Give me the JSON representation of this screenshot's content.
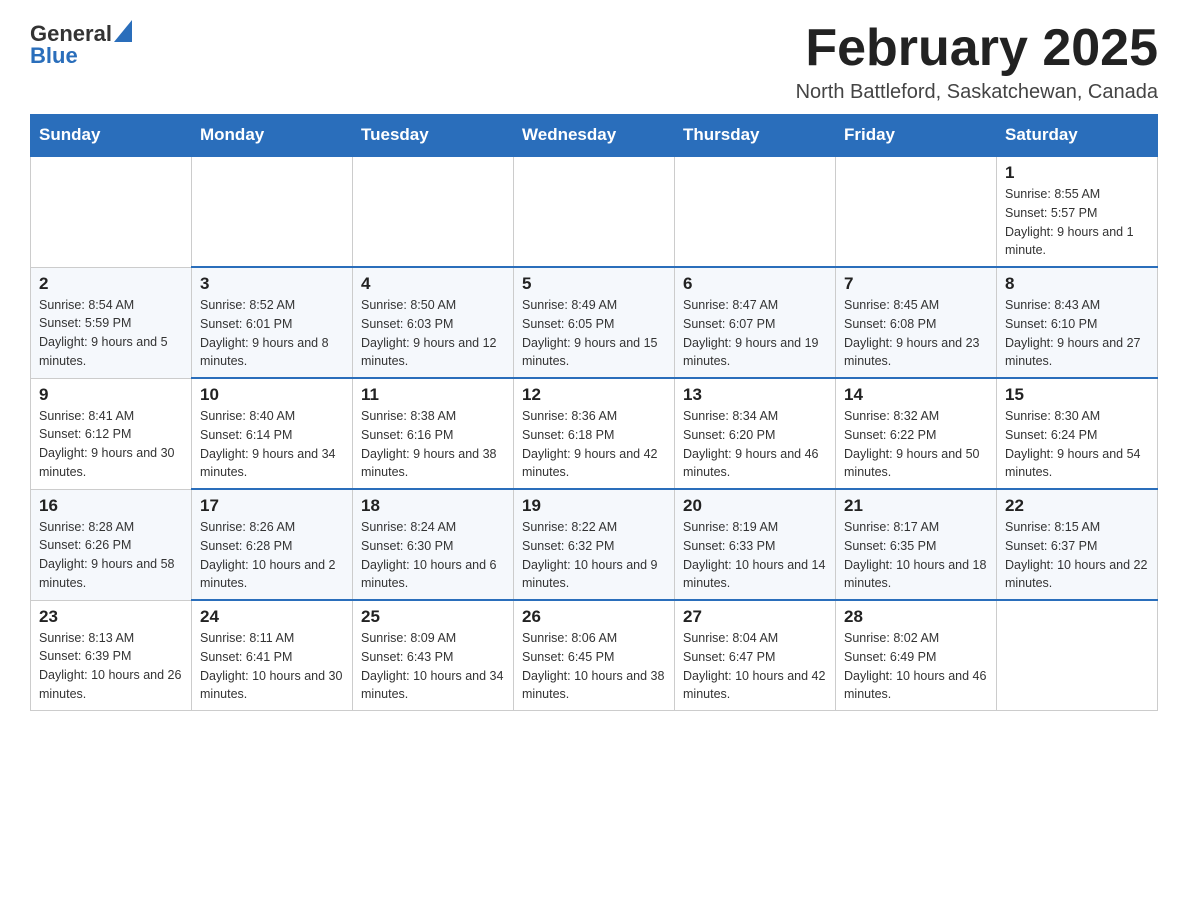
{
  "header": {
    "logo_general": "General",
    "logo_blue": "Blue",
    "month_title": "February 2025",
    "location": "North Battleford, Saskatchewan, Canada"
  },
  "days_of_week": [
    "Sunday",
    "Monday",
    "Tuesday",
    "Wednesday",
    "Thursday",
    "Friday",
    "Saturday"
  ],
  "weeks": [
    {
      "cells": [
        {
          "day": "",
          "info": ""
        },
        {
          "day": "",
          "info": ""
        },
        {
          "day": "",
          "info": ""
        },
        {
          "day": "",
          "info": ""
        },
        {
          "day": "",
          "info": ""
        },
        {
          "day": "",
          "info": ""
        },
        {
          "day": "1",
          "info": "Sunrise: 8:55 AM\nSunset: 5:57 PM\nDaylight: 9 hours and 1 minute."
        }
      ]
    },
    {
      "cells": [
        {
          "day": "2",
          "info": "Sunrise: 8:54 AM\nSunset: 5:59 PM\nDaylight: 9 hours and 5 minutes."
        },
        {
          "day": "3",
          "info": "Sunrise: 8:52 AM\nSunset: 6:01 PM\nDaylight: 9 hours and 8 minutes."
        },
        {
          "day": "4",
          "info": "Sunrise: 8:50 AM\nSunset: 6:03 PM\nDaylight: 9 hours and 12 minutes."
        },
        {
          "day": "5",
          "info": "Sunrise: 8:49 AM\nSunset: 6:05 PM\nDaylight: 9 hours and 15 minutes."
        },
        {
          "day": "6",
          "info": "Sunrise: 8:47 AM\nSunset: 6:07 PM\nDaylight: 9 hours and 19 minutes."
        },
        {
          "day": "7",
          "info": "Sunrise: 8:45 AM\nSunset: 6:08 PM\nDaylight: 9 hours and 23 minutes."
        },
        {
          "day": "8",
          "info": "Sunrise: 8:43 AM\nSunset: 6:10 PM\nDaylight: 9 hours and 27 minutes."
        }
      ]
    },
    {
      "cells": [
        {
          "day": "9",
          "info": "Sunrise: 8:41 AM\nSunset: 6:12 PM\nDaylight: 9 hours and 30 minutes."
        },
        {
          "day": "10",
          "info": "Sunrise: 8:40 AM\nSunset: 6:14 PM\nDaylight: 9 hours and 34 minutes."
        },
        {
          "day": "11",
          "info": "Sunrise: 8:38 AM\nSunset: 6:16 PM\nDaylight: 9 hours and 38 minutes."
        },
        {
          "day": "12",
          "info": "Sunrise: 8:36 AM\nSunset: 6:18 PM\nDaylight: 9 hours and 42 minutes."
        },
        {
          "day": "13",
          "info": "Sunrise: 8:34 AM\nSunset: 6:20 PM\nDaylight: 9 hours and 46 minutes."
        },
        {
          "day": "14",
          "info": "Sunrise: 8:32 AM\nSunset: 6:22 PM\nDaylight: 9 hours and 50 minutes."
        },
        {
          "day": "15",
          "info": "Sunrise: 8:30 AM\nSunset: 6:24 PM\nDaylight: 9 hours and 54 minutes."
        }
      ]
    },
    {
      "cells": [
        {
          "day": "16",
          "info": "Sunrise: 8:28 AM\nSunset: 6:26 PM\nDaylight: 9 hours and 58 minutes."
        },
        {
          "day": "17",
          "info": "Sunrise: 8:26 AM\nSunset: 6:28 PM\nDaylight: 10 hours and 2 minutes."
        },
        {
          "day": "18",
          "info": "Sunrise: 8:24 AM\nSunset: 6:30 PM\nDaylight: 10 hours and 6 minutes."
        },
        {
          "day": "19",
          "info": "Sunrise: 8:22 AM\nSunset: 6:32 PM\nDaylight: 10 hours and 9 minutes."
        },
        {
          "day": "20",
          "info": "Sunrise: 8:19 AM\nSunset: 6:33 PM\nDaylight: 10 hours and 14 minutes."
        },
        {
          "day": "21",
          "info": "Sunrise: 8:17 AM\nSunset: 6:35 PM\nDaylight: 10 hours and 18 minutes."
        },
        {
          "day": "22",
          "info": "Sunrise: 8:15 AM\nSunset: 6:37 PM\nDaylight: 10 hours and 22 minutes."
        }
      ]
    },
    {
      "cells": [
        {
          "day": "23",
          "info": "Sunrise: 8:13 AM\nSunset: 6:39 PM\nDaylight: 10 hours and 26 minutes."
        },
        {
          "day": "24",
          "info": "Sunrise: 8:11 AM\nSunset: 6:41 PM\nDaylight: 10 hours and 30 minutes."
        },
        {
          "day": "25",
          "info": "Sunrise: 8:09 AM\nSunset: 6:43 PM\nDaylight: 10 hours and 34 minutes."
        },
        {
          "day": "26",
          "info": "Sunrise: 8:06 AM\nSunset: 6:45 PM\nDaylight: 10 hours and 38 minutes."
        },
        {
          "day": "27",
          "info": "Sunrise: 8:04 AM\nSunset: 6:47 PM\nDaylight: 10 hours and 42 minutes."
        },
        {
          "day": "28",
          "info": "Sunrise: 8:02 AM\nSunset: 6:49 PM\nDaylight: 10 hours and 46 minutes."
        },
        {
          "day": "",
          "info": ""
        }
      ]
    }
  ]
}
